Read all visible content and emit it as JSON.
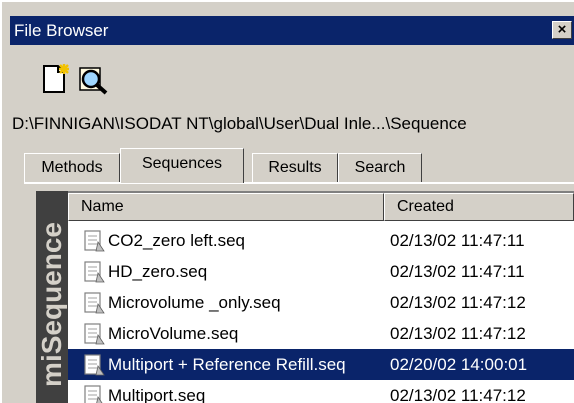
{
  "window": {
    "title": "File Browser",
    "close_glyph": "×"
  },
  "toolbar": {
    "buttons": [
      {
        "icon": "new-document-icon"
      },
      {
        "icon": "magnifier-icon"
      }
    ]
  },
  "path": "D:\\FINNIGAN\\ISODAT NT\\global\\User\\Dual Inle...\\Sequence",
  "tabs": [
    {
      "label": "Methods",
      "active": false
    },
    {
      "label": "Sequences",
      "active": true
    },
    {
      "label": "Results",
      "active": false
    },
    {
      "label": "Search",
      "active": false
    }
  ],
  "sidebar": {
    "label": "miSequence"
  },
  "table": {
    "columns": [
      "Name",
      "Created"
    ],
    "rows": [
      {
        "name": "CO2_zero left.seq",
        "created": "02/13/02 11:47:11",
        "selected": false
      },
      {
        "name": "HD_zero.seq",
        "created": "02/13/02 11:47:11",
        "selected": false
      },
      {
        "name": "Microvolume _only.seq",
        "created": "02/13/02 11:47:12",
        "selected": false
      },
      {
        "name": "MicroVolume.seq",
        "created": "02/13/02 11:47:12",
        "selected": false
      },
      {
        "name": "Multiport + Reference Refill.seq",
        "created": "02/20/02 14:00:01",
        "selected": true
      },
      {
        "name": "Multiport.seq",
        "created": "02/13/02 11:47:12",
        "selected": false
      }
    ]
  },
  "colors": {
    "selection": "#0a246a",
    "face": "#d4d0c8",
    "titlebar": "#0a246a"
  }
}
